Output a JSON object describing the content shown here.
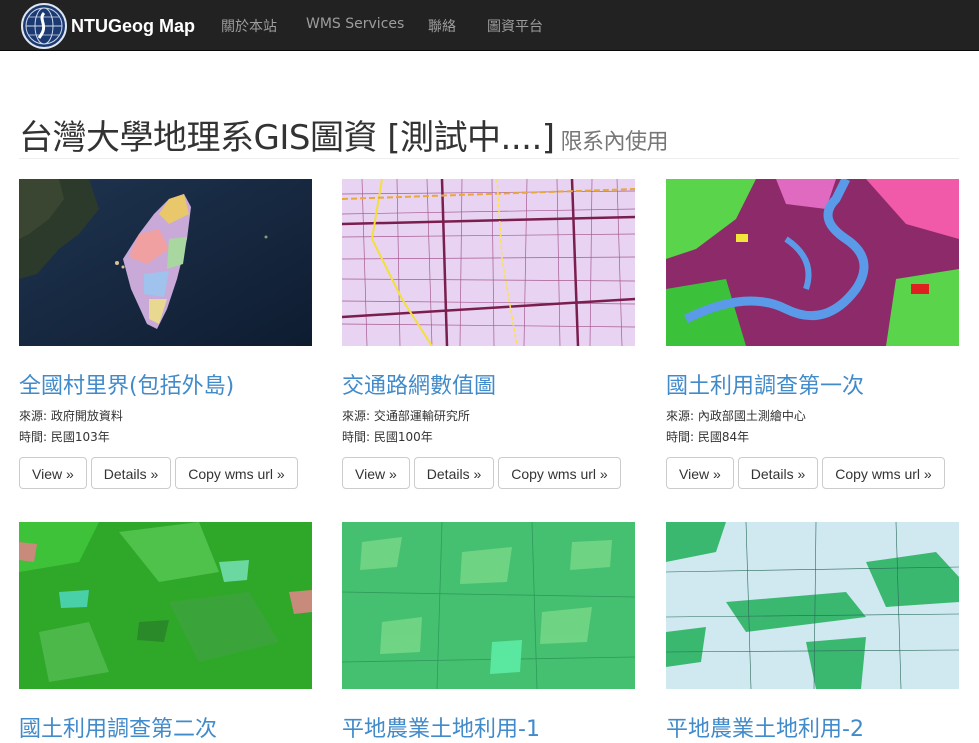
{
  "navbar": {
    "brand": "NTUGeog Map",
    "items": [
      "關於本站",
      "WMS Services",
      "聯絡",
      "圖資平台"
    ]
  },
  "header": {
    "title": "台灣大學地理系GIS圖資 [測試中....]",
    "subtitle": "限系內使用"
  },
  "cards": [
    {
      "title": "全國村里界(包括外島)",
      "source": "來源: 政府開放資料",
      "time": "時間: 民國103年",
      "thumb_icon": "taiwan-map-thumbnail"
    },
    {
      "title": "交通路網數值圖",
      "source": "來源: 交通部運輸研究所",
      "time": "時間: 民國100年",
      "thumb_icon": "road-network-thumbnail"
    },
    {
      "title": "國土利用調查第一次",
      "source": "來源: 內政部國土測繪中心",
      "time": "時間: 民國84年",
      "thumb_icon": "landuse-thumbnail"
    },
    {
      "title": "國土利用調查第二次",
      "thumb_icon": "landuse-2-thumbnail"
    },
    {
      "title": "平地農業土地利用-1",
      "thumb_icon": "farmland-1-thumbnail"
    },
    {
      "title": "平地農業土地利用-2",
      "thumb_icon": "farmland-2-thumbnail"
    }
  ],
  "buttons": {
    "view": "View »",
    "details": "Details »",
    "copy": "Copy wms url »"
  },
  "colors": {
    "navbar": "#222222",
    "link": "#428bca",
    "nav_text": "#9d9d9d"
  }
}
